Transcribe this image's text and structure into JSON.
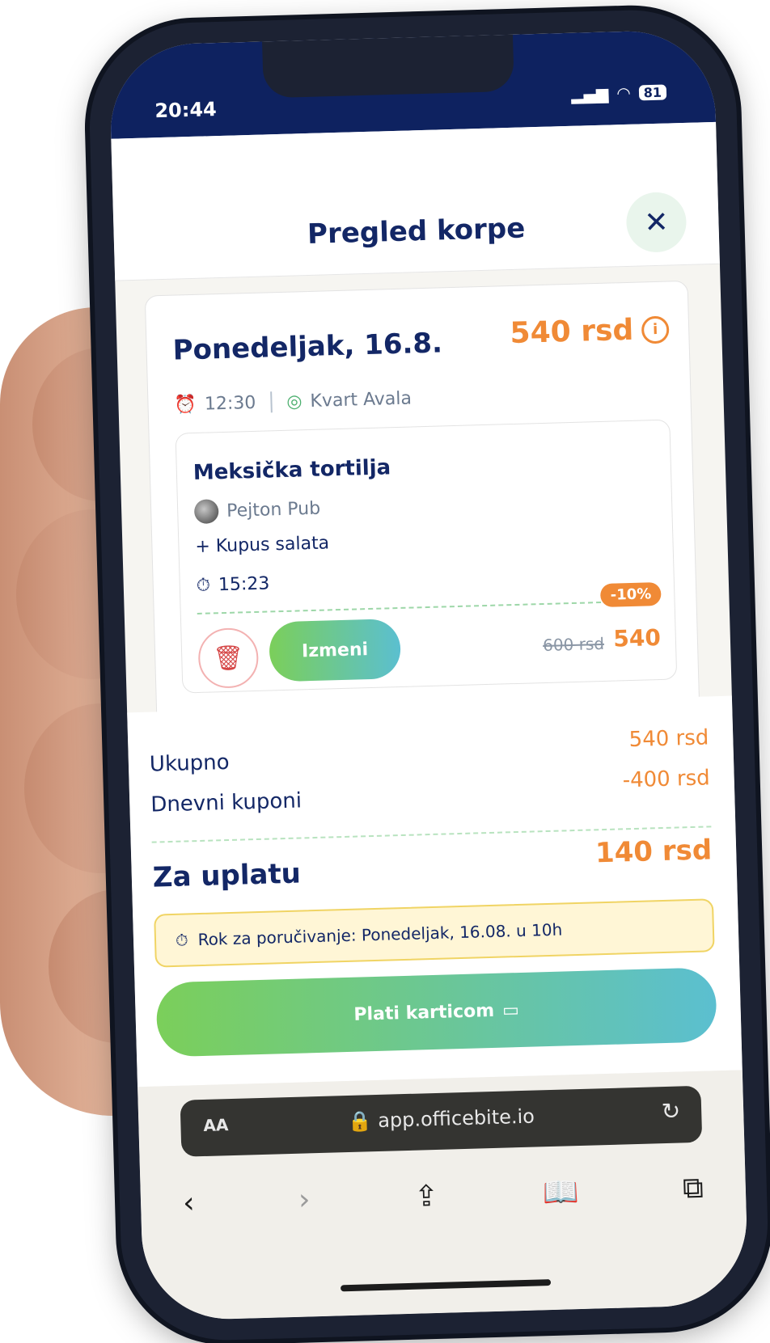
{
  "status_bar": {
    "time": "20:44",
    "signal": "▂▄▆",
    "wifi": "◠",
    "battery": "81"
  },
  "header": {
    "title": "Pregled korpe",
    "close": "✕"
  },
  "order": {
    "day": "Ponedeljak, 16.8.",
    "price": "540 rsd",
    "time": "12:30",
    "location": "Kvart Avala",
    "item": {
      "name": "Meksička tortilja",
      "restaurant": "Pejton Pub",
      "extra": "+ Kupus salata",
      "timer": "15:23",
      "discount": "-10%",
      "old_price": "600 rsd",
      "new_price": "540",
      "edit_label": "Izmeni"
    }
  },
  "summary": {
    "total_label": "Ukupno",
    "total_value": "540 rsd",
    "coupons_label": "Dnevni kuponi",
    "coupons_value": "-400 rsd",
    "pay_label": "Za uplatu",
    "pay_value": "140 rsd",
    "deadline": "Rok za poručivanje: Ponedeljak, 16.08. u 10h",
    "pay_button": "Plati karticom"
  },
  "browser": {
    "aa": "AA",
    "url": "app.officebite.io"
  }
}
